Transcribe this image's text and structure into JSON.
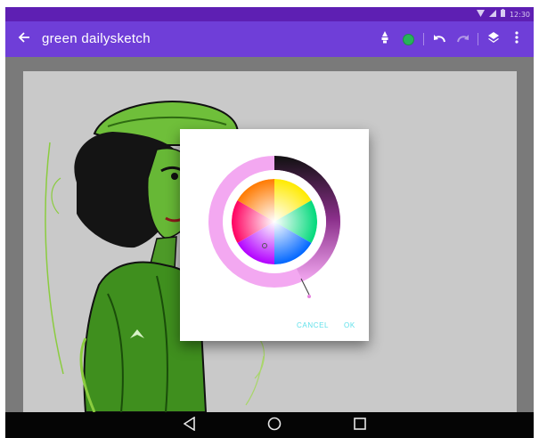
{
  "status_bar": {
    "wifi_icon": "wifi-icon",
    "signal_icon": "signal-icon",
    "battery_icon": "battery-icon",
    "time": "12:30"
  },
  "app_bar": {
    "title": "green dailysketch",
    "background_color": "#6f3ed8",
    "back_icon": "arrow-left-icon",
    "brush_icon": "brush-icon",
    "current_color": "#27b35a",
    "undo_icon": "undo-icon",
    "redo_icon": "redo-icon",
    "layers_icon": "layers-icon",
    "more_icon": "more-vertical-icon"
  },
  "color_dialog": {
    "cancel_label": "CANCEL",
    "ok_label": "OK",
    "selected_color": "#f3a8f1",
    "accent_color": "#5fe0ea"
  },
  "nav_bar": {
    "back_icon": "nav-back-icon",
    "home_icon": "nav-home-icon",
    "recents_icon": "nav-recents-icon"
  }
}
